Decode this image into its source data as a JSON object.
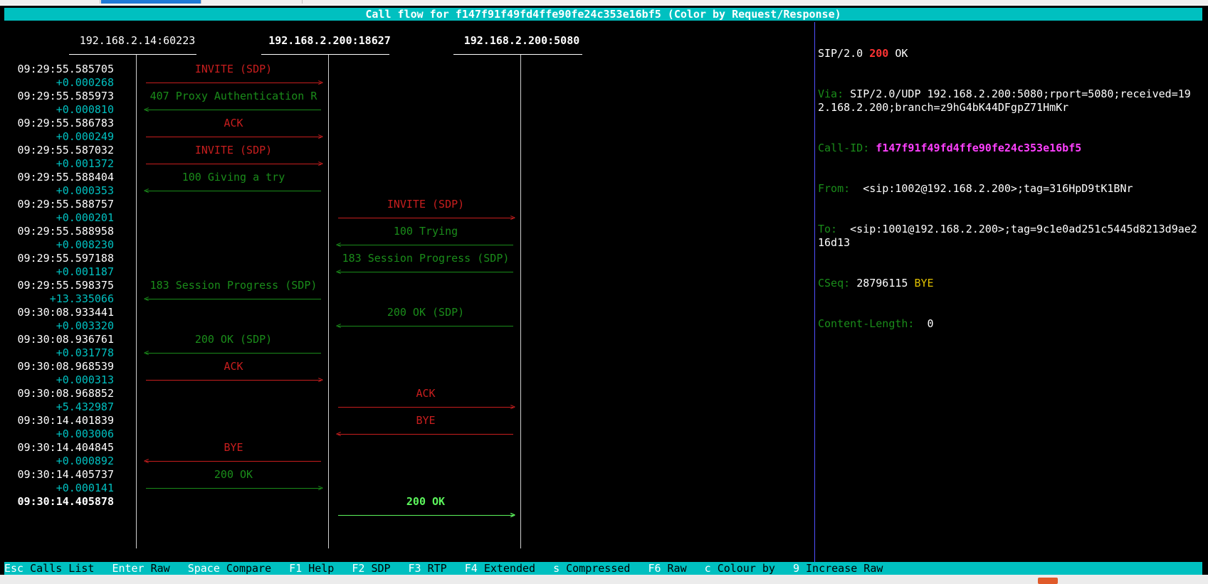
{
  "title": "Call flow for f147f91f49fd4ffe90fe24c353e16bf5 (Color by Request/Response)",
  "hosts": [
    "192.168.2.14:60223",
    "192.168.2.200:18627",
    "192.168.2.200:5080"
  ],
  "messages": [
    {
      "time": "09:29:55.585705",
      "delta": "+0.000268",
      "label": "INVITE (SDP)",
      "type": "req",
      "from": 0,
      "to": 1
    },
    {
      "time": "09:29:55.585973",
      "delta": "+0.000810",
      "label": "407 Proxy Authentication R",
      "type": "res",
      "from": 1,
      "to": 0
    },
    {
      "time": "09:29:55.586783",
      "delta": "+0.000249",
      "label": "ACK",
      "type": "req",
      "from": 0,
      "to": 1
    },
    {
      "time": "09:29:55.587032",
      "delta": "+0.001372",
      "label": "INVITE (SDP)",
      "type": "req",
      "from": 0,
      "to": 1
    },
    {
      "time": "09:29:55.588404",
      "delta": "+0.000353",
      "label": "100 Giving a try",
      "type": "res",
      "from": 1,
      "to": 0
    },
    {
      "time": "09:29:55.588757",
      "delta": "+0.000201",
      "label": "INVITE (SDP)",
      "type": "req",
      "from": 1,
      "to": 2
    },
    {
      "time": "09:29:55.588958",
      "delta": "+0.008230",
      "label": "100 Trying",
      "type": "res",
      "from": 2,
      "to": 1
    },
    {
      "time": "09:29:55.597188",
      "delta": "+0.001187",
      "label": "183 Session Progress (SDP)",
      "type": "res",
      "from": 2,
      "to": 1
    },
    {
      "time": "09:29:55.598375",
      "delta": "+13.335066",
      "label": "183 Session Progress (SDP)",
      "type": "res",
      "from": 1,
      "to": 0
    },
    {
      "time": "09:30:08.933441",
      "delta": "+0.003320",
      "label": "200 OK (SDP)",
      "type": "res",
      "from": 2,
      "to": 1
    },
    {
      "time": "09:30:08.936761",
      "delta": "+0.031778",
      "label": "200 OK (SDP)",
      "type": "res",
      "from": 1,
      "to": 0
    },
    {
      "time": "09:30:08.968539",
      "delta": "+0.000313",
      "label": "ACK",
      "type": "req",
      "from": 0,
      "to": 1
    },
    {
      "time": "09:30:08.968852",
      "delta": "+5.432987",
      "label": "ACK",
      "type": "req",
      "from": 1,
      "to": 2
    },
    {
      "time": "09:30:14.401839",
      "delta": "+0.003006",
      "label": "BYE",
      "type": "req",
      "from": 2,
      "to": 1
    },
    {
      "time": "09:30:14.404845",
      "delta": "+0.000892",
      "label": "BYE",
      "type": "req",
      "from": 1,
      "to": 0
    },
    {
      "time": "09:30:14.405737",
      "delta": "+0.000141",
      "label": "200 OK",
      "type": "res",
      "from": 0,
      "to": 1
    },
    {
      "time": "09:30:14.405878",
      "delta": "",
      "label": "200 OK",
      "type": "sel",
      "from": 1,
      "to": 2
    }
  ],
  "raw": {
    "status_proto": "SIP/2.0",
    "status_code": "200",
    "status_text": "OK",
    "via_label": "Via:",
    "via_value": "SIP/2.0/UDP 192.168.2.200:5080;rport=5080;received=192.168.2.200;branch=z9hG4bK44DFgpZ71HmKr",
    "callid_label": "Call-ID:",
    "callid_value": "f147f91f49fd4ffe90fe24c353e16bf5",
    "from_label": "From:",
    "from_value": "<sip:1002@192.168.2.200>;tag=316HpD9tK1BNr",
    "to_label": "To:",
    "to_value": "<sip:1001@192.168.2.200>;tag=9c1e0ad251c5445d8213d9ae216d13",
    "cseq_label": "CSeq:",
    "cseq_num": "28796115",
    "cseq_method": "BYE",
    "cl_label": "Content-Length:",
    "cl_value": "0"
  },
  "footer": [
    {
      "key": "Esc",
      "label": "Calls List"
    },
    {
      "key": "Enter",
      "label": "Raw"
    },
    {
      "key": "Space",
      "label": "Compare"
    },
    {
      "key": "F1",
      "label": "Help"
    },
    {
      "key": "F2",
      "label": "SDP"
    },
    {
      "key": "F3",
      "label": "RTP"
    },
    {
      "key": "F4",
      "label": "Extended"
    },
    {
      "key": "s",
      "label": "Compressed"
    },
    {
      "key": "F6",
      "label": "Raw"
    },
    {
      "key": "c",
      "label": "Colour by"
    },
    {
      "key": "9",
      "label": "Increase Raw"
    }
  ]
}
